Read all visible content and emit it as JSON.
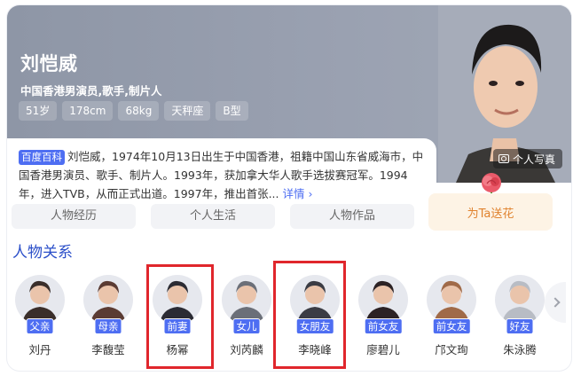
{
  "profile": {
    "name": "刘恺威",
    "subtitle": "中国香港男演员,歌手,制片人",
    "tags": [
      "51岁",
      "178cm",
      "68kg",
      "天秤座",
      "B型"
    ],
    "photo_button": "个人写真"
  },
  "intro": {
    "source_badge": "百度百科",
    "text": "刘恺威，1974年10月13日出生于中国香港，祖籍中国山东省威海市，中国香港男演员、歌手、制片人。1993年，获加拿大华人歌手选拔赛冠军。1994年，进入TVB，从而正式出道。1997年，推出首张...",
    "more_label": "详情"
  },
  "flower_button": "为Ta送花",
  "tabs": [
    "人物经历",
    "个人生活",
    "人物作品"
  ],
  "relations": {
    "title": "人物关系",
    "people": [
      {
        "role": "父亲",
        "name": "刘丹",
        "avatar_color": "#3a2e2a"
      },
      {
        "role": "母亲",
        "name": "李馥莹",
        "avatar_color": "#5a3b33"
      },
      {
        "role": "前妻",
        "name": "杨幂",
        "avatar_color": "#2b2b33"
      },
      {
        "role": "女儿",
        "name": "刘芮麟",
        "avatar_color": "#6b6f78"
      },
      {
        "role": "女朋友",
        "name": "李晓峰",
        "avatar_color": "#3b3c44"
      },
      {
        "role": "前女友",
        "name": "廖碧儿",
        "avatar_color": "#2c2224"
      },
      {
        "role": "前女友",
        "name": "邝文珣",
        "avatar_color": "#a06a48"
      },
      {
        "role": "好友",
        "name": "朱泳腾",
        "avatar_color": "#b8bcc4"
      }
    ]
  },
  "colors": {
    "accent": "#4e6ef2",
    "highlight": "#e0262c",
    "hero_bg": "#9aa1b1",
    "flower_text": "#e0822e"
  }
}
